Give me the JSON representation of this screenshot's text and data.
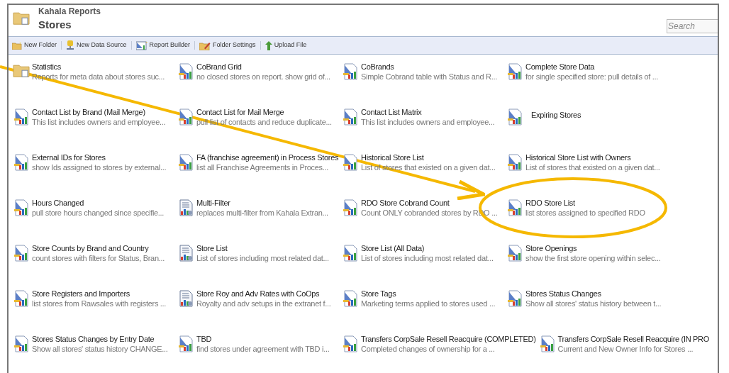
{
  "header": {
    "parent": "Kahala Reports",
    "title": "Stores",
    "search": {
      "placeholder": "Search"
    }
  },
  "toolbar": [
    {
      "label": "New Folder",
      "kind": "folder"
    },
    {
      "label": "New Data Source",
      "kind": "datasource"
    },
    {
      "label": "Report Builder",
      "kind": "builder"
    },
    {
      "label": "Folder Settings",
      "kind": "settings"
    },
    {
      "label": "Upload File",
      "kind": "upload"
    }
  ],
  "items": [
    {
      "title": "Statistics",
      "description": "Reports for meta data about stores suc...",
      "kind": "folder",
      "highlighted": false
    },
    {
      "title": "CoBrand Grid",
      "description": "no closed stores on report. show grid of...",
      "kind": "report",
      "highlighted": false
    },
    {
      "title": "CoBrands",
      "description": "Simple Cobrand table with Status and R...",
      "kind": "report",
      "highlighted": false
    },
    {
      "title": "Complete Store Data",
      "description": "for single specified store: pull details of ...",
      "kind": "report",
      "highlighted": false
    },
    {
      "title": "Contact List by Brand (Mail Merge)",
      "description": "This list includes owners and employee...",
      "kind": "report",
      "highlighted": false
    },
    {
      "title": "Contact List for Mail Merge",
      "description": "pull list of contacts and reduce duplicate...",
      "kind": "report",
      "highlighted": false
    },
    {
      "title": "Contact List Matrix",
      "description": "This list includes owners and employee...",
      "kind": "report",
      "highlighted": false
    },
    {
      "title": "Expiring Stores",
      "kind": "report",
      "highlighted": false
    },
    {
      "title": "External IDs for Stores",
      "description": "show Ids assigned to stores by external...",
      "kind": "report",
      "highlighted": false
    },
    {
      "title": "FA (franchise agreement) in Process Stores",
      "description": "list all Franchise Agreements in Proces...",
      "kind": "report",
      "highlighted": false
    },
    {
      "title": "Historical Store List",
      "description": "List of stores that existed on a given dat...",
      "kind": "report",
      "highlighted": false
    },
    {
      "title": "Historical Store List with Owners",
      "description": "List of stores that existed on a given dat...",
      "kind": "report",
      "highlighted": false
    },
    {
      "title": "Hours Changed",
      "description": "pull store hours changed since specifie...",
      "kind": "report",
      "highlighted": false
    },
    {
      "title": "Multi-Filter",
      "description": "replaces multi-filter from Kahala Extran...",
      "kind": "model",
      "highlighted": false
    },
    {
      "title": "RDO Store Cobrand Count",
      "description": "Count ONLY cobranded stores by RDO ...",
      "kind": "report",
      "highlighted": false
    },
    {
      "title": "RDO Store List",
      "description": "list stores assigned to specified RDO",
      "kind": "report",
      "highlighted": true
    },
    {
      "title": "Store Counts by Brand and Country",
      "description": "count stores with filters for Status, Bran...",
      "kind": "report",
      "highlighted": false
    },
    {
      "title": "Store List",
      "description": "List of stores including most related dat...",
      "kind": "model",
      "highlighted": false
    },
    {
      "title": "Store List (All Data)",
      "description": "List of stores including most related dat...",
      "kind": "report",
      "highlighted": false
    },
    {
      "title": "Store Openings",
      "description": "show the first store opening within selec...",
      "kind": "report",
      "highlighted": false
    },
    {
      "title": "Store Registers and Importers",
      "description": "list stores from Rawsales with registers ...",
      "kind": "report",
      "highlighted": false
    },
    {
      "title": "Store Roy and Adv Rates with CoOps",
      "description": "Royalty and adv setups in the extranet f...",
      "kind": "model",
      "highlighted": false
    },
    {
      "title": "Store Tags",
      "description": "Marketing terms applied to stores used ...",
      "kind": "report",
      "highlighted": false
    },
    {
      "title": "Stores Status Changes",
      "description": "Show all stores' status history between t...",
      "kind": "report",
      "highlighted": false
    },
    {
      "title": "Stores Status Changes by Entry Date",
      "description": "Show all stores' status history CHANGE...",
      "kind": "report",
      "highlighted": false
    },
    {
      "title": "TBD",
      "description": "find stores under agreement with TBD i...",
      "kind": "report",
      "highlighted": false
    },
    {
      "title": "Transfers CorpSale Resell Reacquire (COMPLETED)",
      "description": "Completed changes of ownership for a ...",
      "kind": "report",
      "highlighted": false
    },
    {
      "title": "Transfers CorpSale Resell Reacquire (IN PRO",
      "description": "Current and New Owner Info for Stores ...",
      "kind": "report",
      "highlighted": false
    }
  ]
}
